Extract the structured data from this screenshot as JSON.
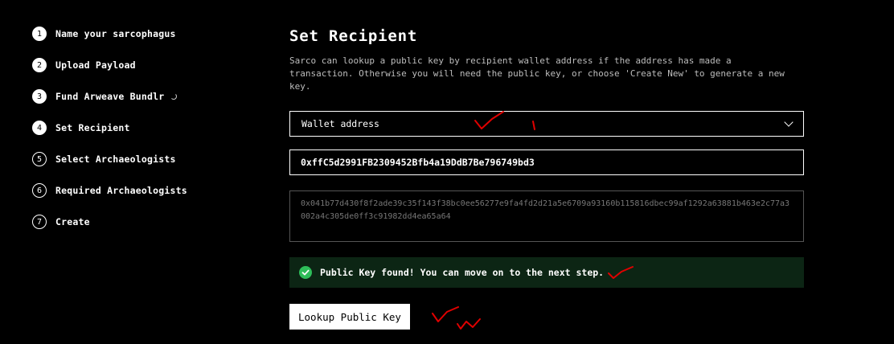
{
  "steps": [
    {
      "num": "1",
      "label": "Name your sarcophagus"
    },
    {
      "num": "2",
      "label": "Upload Payload"
    },
    {
      "num": "3",
      "label": "Fund Arweave Bundlr"
    },
    {
      "num": "4",
      "label": "Set Recipient"
    },
    {
      "num": "5",
      "label": "Select Archaeologists"
    },
    {
      "num": "6",
      "label": "Required Archaeologists"
    },
    {
      "num": "7",
      "label": "Create"
    }
  ],
  "main": {
    "title": "Set Recipient",
    "description": "Sarco can lookup a public key by recipient wallet address if the address has made a transaction. Otherwise you will need the public key, or choose 'Create New' to generate a new key.",
    "select": {
      "value": "Wallet address",
      "icon": "chevron-down-icon"
    },
    "address_input": {
      "value": "0xffC5d2991FB2309452Bfb4a19DdB7Be796749bd3"
    },
    "public_key": {
      "value": "0x041b77d430f8f2ade39c35f143f38bc0ee56277e9fa4fd2d21a5e6709a93160b115816dbec99af1292a63881b463e2c77a3002a4c305de0ff3c91982dd4ea65a64"
    },
    "alert": {
      "text": "Public Key found! You can move on to the next step.",
      "icon": "check-circle-icon",
      "color": "#2ebd59"
    },
    "lookup_button": {
      "label": "Lookup Public Key"
    }
  },
  "colors": {
    "background": "#000000",
    "alert_bg": "#0c2514",
    "annotation": "#e00000"
  }
}
